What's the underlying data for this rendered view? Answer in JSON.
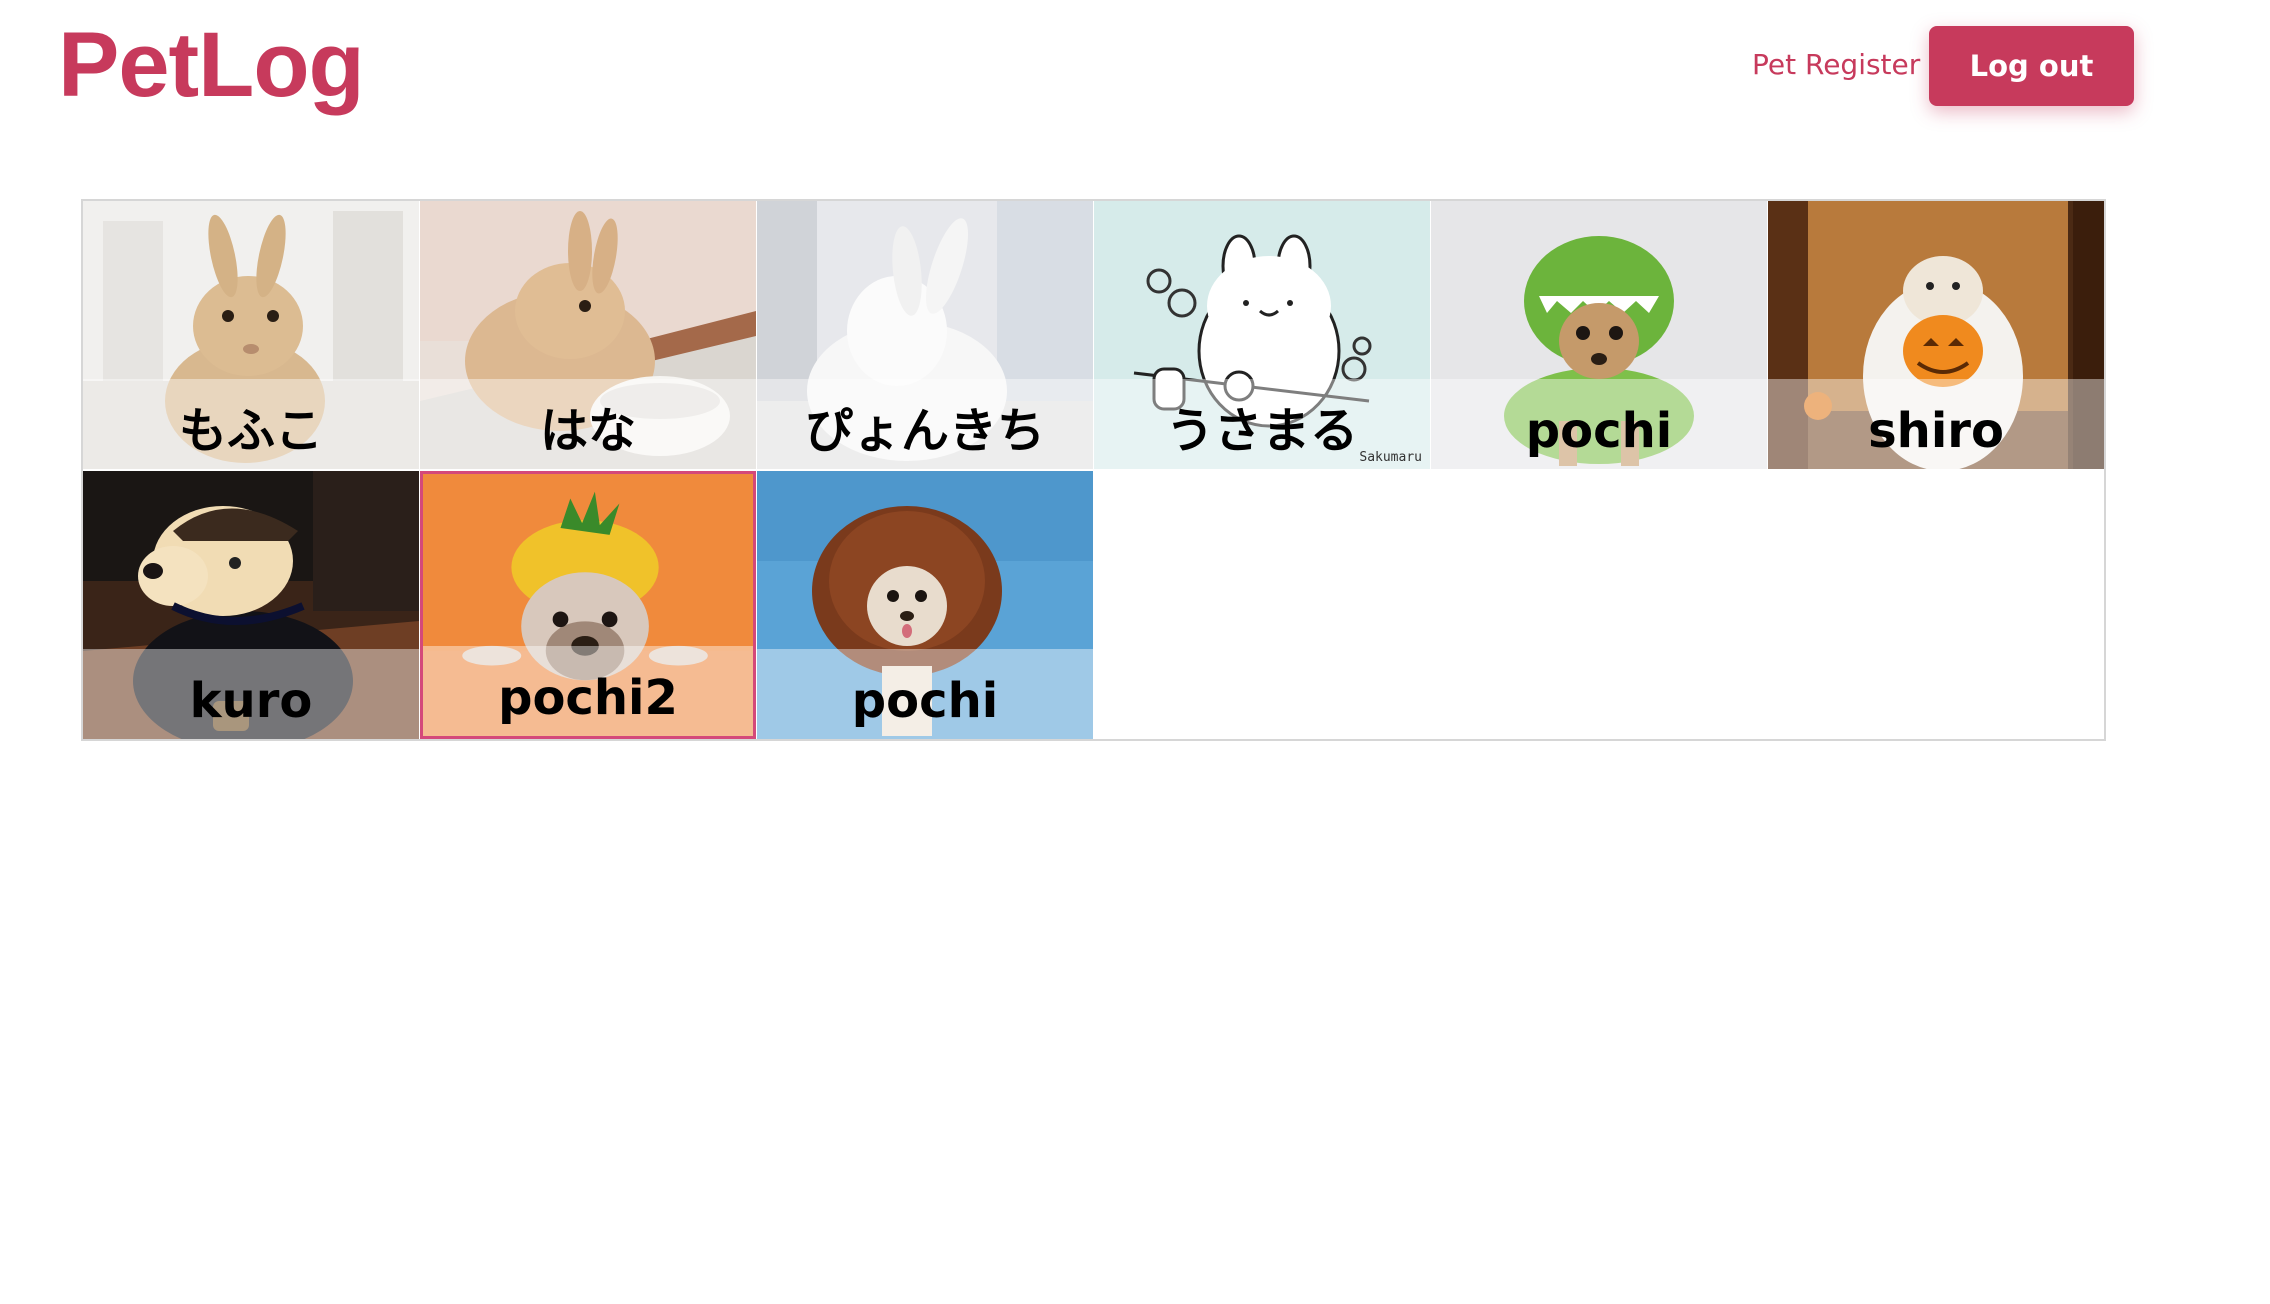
{
  "header": {
    "logo": "PetLog",
    "pet_register_label": "Pet Register",
    "logout_label": "Log out"
  },
  "pets": [
    {
      "name": "もふこ",
      "animal": "rabbit"
    },
    {
      "name": "はな",
      "animal": "rabbit"
    },
    {
      "name": "ぴょんきち",
      "animal": "rabbit"
    },
    {
      "name": "うさまる",
      "animal": "rabbit-illustration",
      "watermark": "Sakumaru"
    },
    {
      "name": "pochi",
      "animal": "dog"
    },
    {
      "name": "shiro",
      "animal": "dog"
    },
    {
      "name": "kuro",
      "animal": "dog"
    },
    {
      "name": "pochi2",
      "animal": "dog",
      "selected": true
    },
    {
      "name": "pochi",
      "animal": "dog"
    }
  ],
  "colors": {
    "brand": "#c73a5c",
    "selected_border": "#d4497a"
  }
}
